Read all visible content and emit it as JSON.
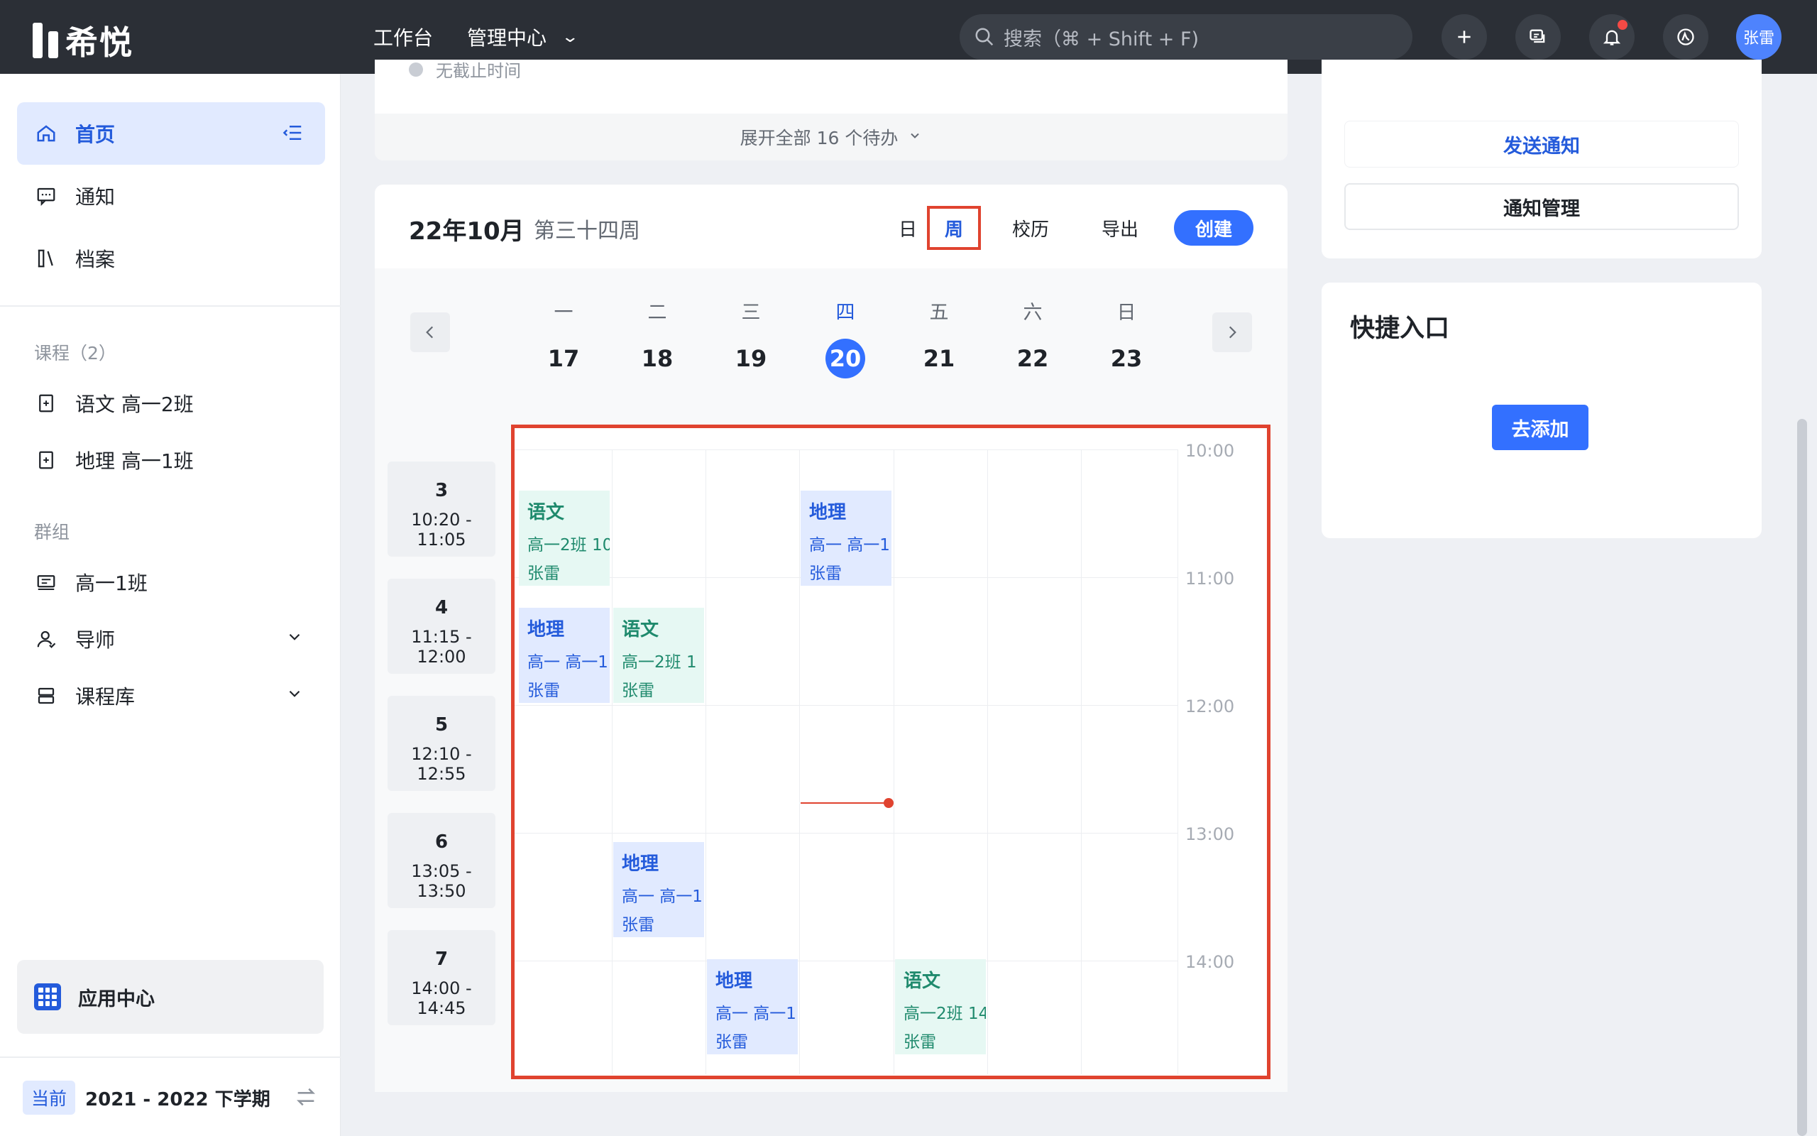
{
  "app": {
    "name": "希悦"
  },
  "topbar": {
    "nav_workbench": "工作台",
    "nav_admin": "管理中心",
    "search_placeholder": "搜索（⌘ + Shift + F)",
    "user_name": "张雷"
  },
  "sidebar": {
    "home": "首页",
    "notice": "通知",
    "archive": "档案",
    "courses_section": "课程（2）",
    "course_items": [
      "语文 高一2班",
      "地理 高一1班"
    ],
    "groups_section": "群组",
    "group_item": "高一1班",
    "mentor": "导师",
    "course_library": "课程库",
    "app_center": "应用中心",
    "semester_tag": "当前",
    "semester": "2021 - 2022 下学期"
  },
  "todo": {
    "peek_text": "无截止时间",
    "expand_label": "展开全部 16 个待办"
  },
  "calendar": {
    "title": "22年10月",
    "week_label": "第三十四周",
    "views": {
      "day": "日",
      "week": "周",
      "school": "校历",
      "export": "导出",
      "create": "创建"
    },
    "days": [
      {
        "wd": "一",
        "dn": "17"
      },
      {
        "wd": "二",
        "dn": "18"
      },
      {
        "wd": "三",
        "dn": "19"
      },
      {
        "wd": "四",
        "dn": "20"
      },
      {
        "wd": "五",
        "dn": "21"
      },
      {
        "wd": "六",
        "dn": "22"
      },
      {
        "wd": "日",
        "dn": "23"
      }
    ],
    "periods": [
      {
        "n": "3",
        "t": "10:20 - 11:05"
      },
      {
        "n": "4",
        "t": "11:15 - 12:00"
      },
      {
        "n": "5",
        "t": "12:10 - 12:55"
      },
      {
        "n": "6",
        "t": "13:05 - 13:50"
      },
      {
        "n": "7",
        "t": "14:00 - 14:45"
      }
    ],
    "times": [
      "10:00",
      "11:00",
      "12:00",
      "13:00",
      "14:00"
    ],
    "events": [
      {
        "name": "语文",
        "desc": "高一2班  10",
        "teacher": "张雷"
      },
      {
        "name": "地理",
        "desc": "高一  高一1",
        "teacher": "张雷"
      },
      {
        "name": "地理",
        "desc": "高一  高一1",
        "teacher": "张雷"
      },
      {
        "name": "语文",
        "desc": "高一2班  1",
        "teacher": "张雷"
      },
      {
        "name": "地理",
        "desc": "高一  高一1",
        "teacher": "张雷"
      },
      {
        "name": "地理",
        "desc": "高一  高一1",
        "teacher": "张雷"
      },
      {
        "name": "语文",
        "desc": "高一2班  14",
        "teacher": "张雷"
      }
    ]
  },
  "notify": {
    "send": "发送通知",
    "manage": "通知管理"
  },
  "quick": {
    "title": "快捷入口",
    "add": "去添加"
  }
}
